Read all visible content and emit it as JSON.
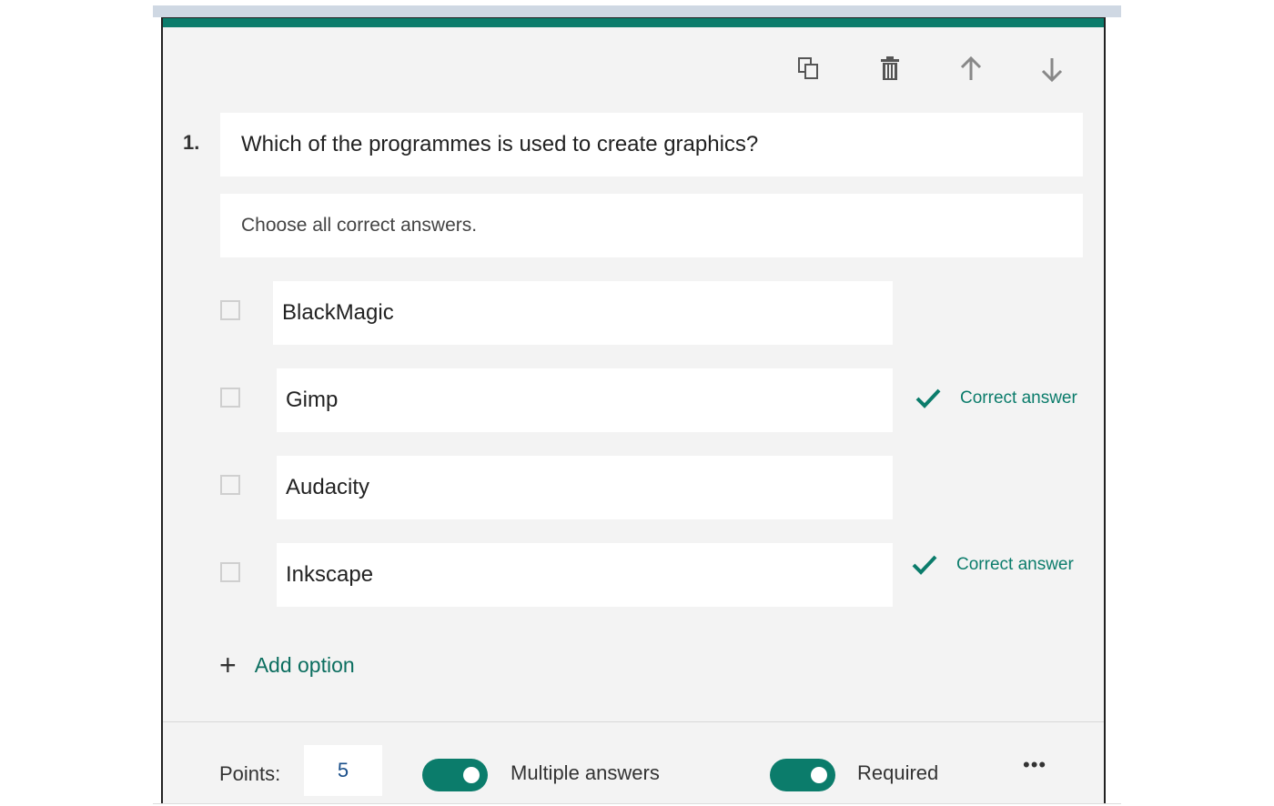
{
  "colors": {
    "accent": "#0b7c6b",
    "card_background": "#f3f3f3",
    "field_background": "#ffffff"
  },
  "toolbar": {
    "icons": [
      "copy-icon",
      "delete-icon",
      "move-up-icon",
      "move-down-icon"
    ]
  },
  "question": {
    "number": "1.",
    "title": "Which of the programmes is used to create graphics?",
    "subtitle": "Choose all correct answers."
  },
  "options": [
    {
      "label": "BlackMagic",
      "checked": false,
      "correct": false
    },
    {
      "label": "Gimp",
      "checked": false,
      "correct": true
    },
    {
      "label": "Audacity",
      "checked": false,
      "correct": false
    },
    {
      "label": "Inkscape",
      "checked": false,
      "correct": true
    }
  ],
  "correct_label": "Correct answer",
  "add_option": {
    "label": "Add option"
  },
  "footer": {
    "points_label": "Points:",
    "points_value": "5",
    "multiple_answers_label": "Multiple answers",
    "multiple_answers_on": true,
    "required_label": "Required",
    "required_on": true,
    "more_label": "•••"
  }
}
